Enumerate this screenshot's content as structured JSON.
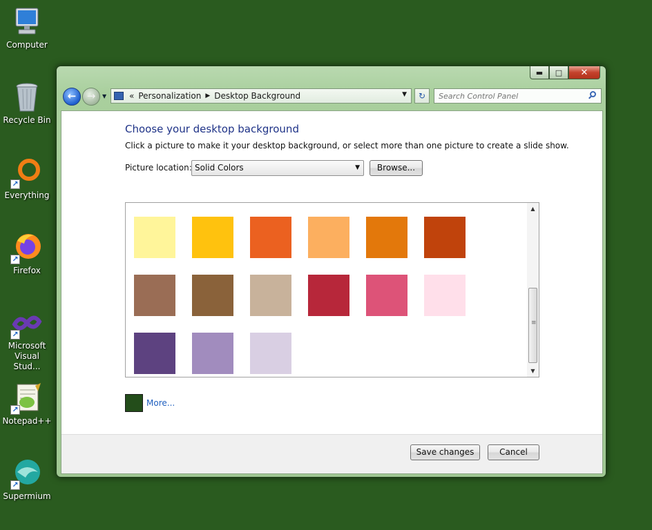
{
  "desktop": {
    "icons": [
      {
        "label": "Computer"
      },
      {
        "label": "Recycle Bin"
      },
      {
        "label": "Everything"
      },
      {
        "label": "Firefox"
      },
      {
        "label": "Microsoft Visual Stud..."
      },
      {
        "label": "Notepad++"
      },
      {
        "label": "Supermium"
      }
    ],
    "shortcut_glyph": "↗"
  },
  "window": {
    "caption_buttons": {
      "minimize": "▬",
      "maximize": "□",
      "close": "✕"
    },
    "nav": {
      "back": "←",
      "forward": "→",
      "dropdown": "▼"
    },
    "address": {
      "overflow": "«",
      "crumbs": [
        "Personalization",
        "Desktop Background"
      ],
      "separator": "▶",
      "dropdown": "▼"
    },
    "refresh": "↻",
    "search": {
      "placeholder": "Search Control Panel"
    }
  },
  "content": {
    "title": "Choose your desktop background",
    "subtitle": "Click a picture to make it your desktop background, or select more than one picture to create a slide show.",
    "location_label": "Picture location:",
    "location_value": "Solid Colors",
    "location_arrow": "▼",
    "browse_label": "Browse...",
    "swatches": [
      {
        "color": "#FFF59A"
      },
      {
        "color": "#FFC20E"
      },
      {
        "color": "#EB6120"
      },
      {
        "color": "#FCAF5F"
      },
      {
        "color": "#E3780B"
      },
      {
        "color": "#C0430C"
      },
      {
        "color": "#9A6D55"
      },
      {
        "color": "#8A623A"
      },
      {
        "color": "#C8B29B"
      },
      {
        "color": "#B7273A"
      },
      {
        "color": "#DD5378"
      },
      {
        "color": "#FFDFEA"
      },
      {
        "color": "#5D4280"
      },
      {
        "color": "#A18CBE"
      },
      {
        "color": "#D9CFE3"
      }
    ],
    "scroll": {
      "up": "▲",
      "down": "▼",
      "grip": "≡"
    },
    "current_color": "#234D1A",
    "more_label": "More...",
    "save_label": "Save changes",
    "cancel_label": "Cancel"
  }
}
